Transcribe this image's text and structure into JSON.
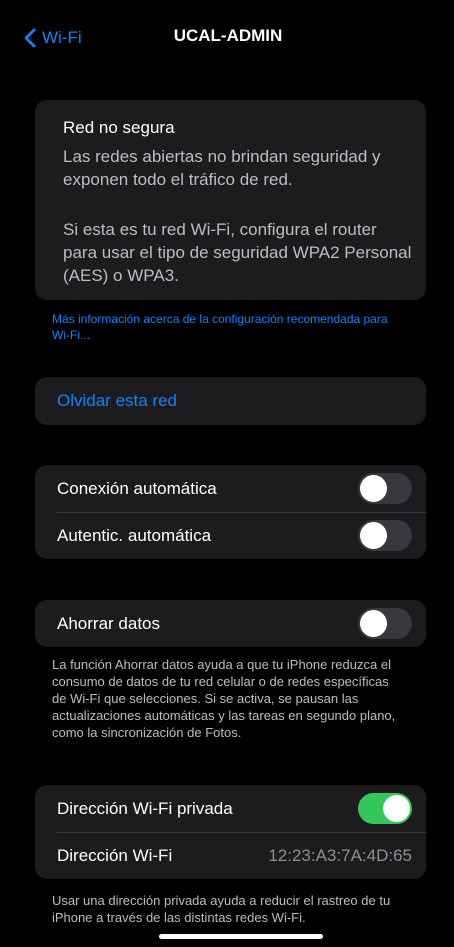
{
  "nav": {
    "back_label": "Wi-Fi",
    "title": "UCAL-ADMIN"
  },
  "warning": {
    "title": "Red no segura",
    "paragraph1": "Las redes abiertas no brindan seguridad y exponen todo el tráfico de red.",
    "paragraph2": "Si esta es tu red Wi-Fi, configura el router para usar el tipo de seguridad WPA2 Personal (AES) o WPA3.",
    "link": "Más información acerca de la configuración recomendada para Wi-Fi..."
  },
  "forget": {
    "label": "Olvidar esta red"
  },
  "auto": {
    "auto_join_label": "Conexión automática",
    "auto_join_on": false,
    "auto_login_label": "Autentic. automática",
    "auto_login_on": false
  },
  "data_saver": {
    "label": "Ahorrar datos",
    "on": false,
    "note": "La función Ahorrar datos ayuda a que tu iPhone reduzca el consumo de datos de tu red celular o de redes específicas de Wi-Fi que selecciones. Si se activa, se pausan las actualizaciones automáticas y las tareas en segundo plano, como la sincronización de Fotos."
  },
  "private": {
    "private_label": "Dirección Wi-Fi privada",
    "private_on": true,
    "address_label": "Dirección Wi-Fi",
    "address_value": "12:23:A3:7A:4D:65",
    "note": "Usar una dirección privada ayuda a reducir el rastreo de tu iPhone a través de las distintas redes Wi-Fi."
  },
  "colors": {
    "accent": "#0a84ff",
    "toggle_on": "#34c759",
    "toggle_off": "#39393d",
    "card": "#1c1c1e",
    "background": "#000000"
  },
  "icons": {
    "back": "chevron-left-icon"
  }
}
